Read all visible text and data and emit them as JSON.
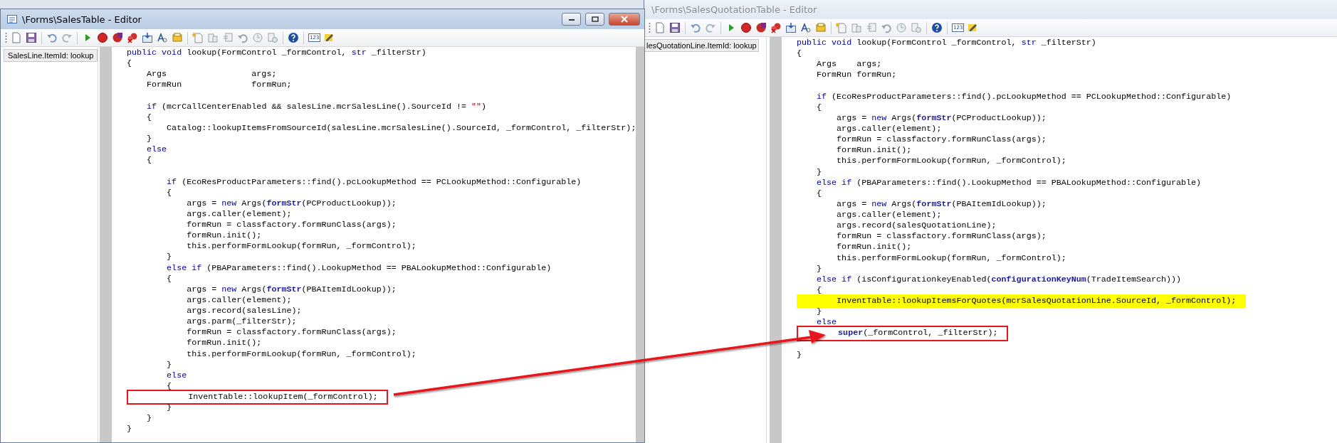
{
  "windows": [
    {
      "title": "\\Forms\\SalesTable - Editor",
      "active": true,
      "toolbar": {
        "badge": "123"
      },
      "tree": {
        "items": [
          {
            "label": "SalesLine.ItemId: lookup",
            "selected": true
          }
        ]
      },
      "code": [
        {
          "kind": "code",
          "segments": [
            {
              "text": "public void",
              "kind": "keyword"
            },
            {
              "text": " lookup(FormControl _formControl, ",
              "kind": "plain"
            },
            {
              "text": "str",
              "kind": "keyword"
            },
            {
              "text": " _filterStr)",
              "kind": "plain"
            }
          ]
        },
        {
          "kind": "code",
          "segments": [
            {
              "text": "{",
              "kind": "plain"
            }
          ]
        },
        {
          "kind": "code",
          "segments": [
            {
              "text": "    Args                 args;",
              "kind": "plain"
            }
          ]
        },
        {
          "kind": "code",
          "segments": [
            {
              "text": "    FormRun              formRun;",
              "kind": "plain"
            }
          ]
        },
        {
          "kind": "blank"
        },
        {
          "kind": "code",
          "segments": [
            {
              "text": "    if",
              "kind": "keyword"
            },
            {
              "text": " (mcrCallCenterEnabled && salesLine.mcrSalesLine().SourceId != ",
              "kind": "plain"
            },
            {
              "text": "\"\"",
              "kind": "string"
            },
            {
              "text": ")",
              "kind": "plain"
            }
          ]
        },
        {
          "kind": "code",
          "segments": [
            {
              "text": "    {",
              "kind": "plain"
            }
          ]
        },
        {
          "kind": "code",
          "segments": [
            {
              "text": "        Catalog::lookupItemsFromSourceId(salesLine.mcrSalesLine().SourceId, _formControl, _filterStr);",
              "kind": "plain"
            }
          ]
        },
        {
          "kind": "code",
          "segments": [
            {
              "text": "    }",
              "kind": "plain"
            }
          ]
        },
        {
          "kind": "code",
          "segments": [
            {
              "text": "    else",
              "kind": "keyword"
            }
          ]
        },
        {
          "kind": "code",
          "segments": [
            {
              "text": "    {",
              "kind": "plain"
            }
          ]
        },
        {
          "kind": "blank"
        },
        {
          "kind": "code",
          "segments": [
            {
              "text": "        if",
              "kind": "keyword"
            },
            {
              "text": " (EcoResProductParameters::find().pcLookupMethod == PCLookupMethod::Configurable)",
              "kind": "plain"
            }
          ]
        },
        {
          "kind": "code",
          "segments": [
            {
              "text": "        {",
              "kind": "plain"
            }
          ]
        },
        {
          "kind": "code",
          "segments": [
            {
              "text": "            args = ",
              "kind": "plain"
            },
            {
              "text": "new",
              "kind": "keyword"
            },
            {
              "text": " Args(",
              "kind": "plain"
            },
            {
              "text": "formStr",
              "kind": "function"
            },
            {
              "text": "(PCProductLookup));",
              "kind": "plain"
            }
          ]
        },
        {
          "kind": "code",
          "segments": [
            {
              "text": "            args.caller(element);",
              "kind": "plain"
            }
          ]
        },
        {
          "kind": "code",
          "segments": [
            {
              "text": "            formRun = classfactory.formRunClass(args);",
              "kind": "plain"
            }
          ]
        },
        {
          "kind": "code",
          "segments": [
            {
              "text": "            formRun.init();",
              "kind": "plain"
            }
          ]
        },
        {
          "kind": "code",
          "segments": [
            {
              "text": "            this.performFormLookup(formRun, _formControl);",
              "kind": "plain"
            }
          ]
        },
        {
          "kind": "code",
          "segments": [
            {
              "text": "        }",
              "kind": "plain"
            }
          ]
        },
        {
          "kind": "code",
          "segments": [
            {
              "text": "        else if",
              "kind": "keyword"
            },
            {
              "text": " (PBAParameters::find().LookupMethod == PBALookupMethod::Configurable)",
              "kind": "plain"
            }
          ]
        },
        {
          "kind": "code",
          "segments": [
            {
              "text": "        {",
              "kind": "plain"
            }
          ]
        },
        {
          "kind": "code",
          "segments": [
            {
              "text": "            args = ",
              "kind": "plain"
            },
            {
              "text": "new",
              "kind": "keyword"
            },
            {
              "text": " Args(",
              "kind": "plain"
            },
            {
              "text": "formStr",
              "kind": "function"
            },
            {
              "text": "(PBAItemIdLookup));",
              "kind": "plain"
            }
          ]
        },
        {
          "kind": "code",
          "segments": [
            {
              "text": "            args.caller(element);",
              "kind": "plain"
            }
          ]
        },
        {
          "kind": "code",
          "segments": [
            {
              "text": "            args.record(salesLine);",
              "kind": "plain"
            }
          ]
        },
        {
          "kind": "code",
          "segments": [
            {
              "text": "            args.parm(_filterStr);",
              "kind": "plain"
            }
          ]
        },
        {
          "kind": "code",
          "segments": [
            {
              "text": "            formRun = classfactory.formRunClass(args);",
              "kind": "plain"
            }
          ]
        },
        {
          "kind": "code",
          "segments": [
            {
              "text": "            formRun.init();",
              "kind": "plain"
            }
          ]
        },
        {
          "kind": "code",
          "segments": [
            {
              "text": "            this.performFormLookup(formRun, _formControl);",
              "kind": "plain"
            }
          ]
        },
        {
          "kind": "code",
          "segments": [
            {
              "text": "        }",
              "kind": "plain"
            }
          ]
        },
        {
          "kind": "code",
          "segments": [
            {
              "text": "        else",
              "kind": "keyword"
            }
          ]
        },
        {
          "kind": "code",
          "segments": [
            {
              "text": "        {",
              "kind": "plain"
            }
          ]
        },
        {
          "kind": "code",
          "boxed": true,
          "segments": [
            {
              "text": "            InventTable::lookupItem(_formControl);",
              "kind": "plain"
            }
          ]
        },
        {
          "kind": "code",
          "segments": [
            {
              "text": "        }",
              "kind": "plain"
            }
          ]
        },
        {
          "kind": "code",
          "segments": [
            {
              "text": "    }",
              "kind": "plain"
            }
          ]
        },
        {
          "kind": "code",
          "segments": [
            {
              "text": "}",
              "kind": "plain"
            }
          ]
        }
      ]
    },
    {
      "title": "\\Forms\\SalesQuotationTable - Editor",
      "active": false,
      "toolbar": {
        "badge": "123"
      },
      "tree": {
        "items": [
          {
            "label": "lesQuotationLine.ItemId: lookup",
            "selected": true
          }
        ]
      },
      "code": [
        {
          "kind": "code",
          "segments": [
            {
              "text": "public void",
              "kind": "keyword"
            },
            {
              "text": " lookup(FormControl _formControl, ",
              "kind": "plain"
            },
            {
              "text": "str",
              "kind": "keyword"
            },
            {
              "text": " _filterStr)",
              "kind": "plain"
            }
          ]
        },
        {
          "kind": "code",
          "segments": [
            {
              "text": "{",
              "kind": "plain"
            }
          ]
        },
        {
          "kind": "code",
          "segments": [
            {
              "text": "    Args    args;",
              "kind": "plain"
            }
          ]
        },
        {
          "kind": "code",
          "segments": [
            {
              "text": "    FormRun formRun;",
              "kind": "plain"
            }
          ]
        },
        {
          "kind": "blank"
        },
        {
          "kind": "code",
          "segments": [
            {
              "text": "    if",
              "kind": "keyword"
            },
            {
              "text": " (EcoResProductParameters::find().pcLookupMethod == PCLookupMethod::Configurable)",
              "kind": "plain"
            }
          ]
        },
        {
          "kind": "code",
          "segments": [
            {
              "text": "    {",
              "kind": "plain"
            }
          ]
        },
        {
          "kind": "code",
          "segments": [
            {
              "text": "        args = ",
              "kind": "plain"
            },
            {
              "text": "new",
              "kind": "keyword"
            },
            {
              "text": " Args(",
              "kind": "plain"
            },
            {
              "text": "formStr",
              "kind": "function"
            },
            {
              "text": "(PCProductLookup));",
              "kind": "plain"
            }
          ]
        },
        {
          "kind": "code",
          "segments": [
            {
              "text": "        args.caller(element);",
              "kind": "plain"
            }
          ]
        },
        {
          "kind": "code",
          "segments": [
            {
              "text": "        formRun = classfactory.formRunClass(args);",
              "kind": "plain"
            }
          ]
        },
        {
          "kind": "code",
          "segments": [
            {
              "text": "        formRun.init();",
              "kind": "plain"
            }
          ]
        },
        {
          "kind": "code",
          "segments": [
            {
              "text": "        this.performFormLookup(formRun, _formControl);",
              "kind": "plain"
            }
          ]
        },
        {
          "kind": "code",
          "segments": [
            {
              "text": "    }",
              "kind": "plain"
            }
          ]
        },
        {
          "kind": "code",
          "segments": [
            {
              "text": "    else if",
              "kind": "keyword"
            },
            {
              "text": " (PBAParameters::find().LookupMethod == PBALookupMethod::Configurable)",
              "kind": "plain"
            }
          ]
        },
        {
          "kind": "code",
          "segments": [
            {
              "text": "    {",
              "kind": "plain"
            }
          ]
        },
        {
          "kind": "code",
          "segments": [
            {
              "text": "        args = ",
              "kind": "plain"
            },
            {
              "text": "new",
              "kind": "keyword"
            },
            {
              "text": " Args(",
              "kind": "plain"
            },
            {
              "text": "formStr",
              "kind": "function"
            },
            {
              "text": "(PBAItemIdLookup));",
              "kind": "plain"
            }
          ]
        },
        {
          "kind": "code",
          "segments": [
            {
              "text": "        args.caller(element);",
              "kind": "plain"
            }
          ]
        },
        {
          "kind": "code",
          "segments": [
            {
              "text": "        args.record(salesQuotationLine);",
              "kind": "plain"
            }
          ]
        },
        {
          "kind": "code",
          "segments": [
            {
              "text": "        formRun = classfactory.formRunClass(args);",
              "kind": "plain"
            }
          ]
        },
        {
          "kind": "code",
          "segments": [
            {
              "text": "        formRun.init();",
              "kind": "plain"
            }
          ]
        },
        {
          "kind": "code",
          "segments": [
            {
              "text": "        this.performFormLookup(formRun, _formControl);",
              "kind": "plain"
            }
          ]
        },
        {
          "kind": "code",
          "segments": [
            {
              "text": "    }",
              "kind": "plain"
            }
          ]
        },
        {
          "kind": "code",
          "segments": [
            {
              "text": "    else if",
              "kind": "keyword"
            },
            {
              "text": " (isConfigurationkeyEnabled(",
              "kind": "plain"
            },
            {
              "text": "configurationKeyNum",
              "kind": "function"
            },
            {
              "text": "(TradeItemSearch)))",
              "kind": "plain"
            }
          ]
        },
        {
          "kind": "code",
          "segments": [
            {
              "text": "    {",
              "kind": "plain"
            }
          ]
        },
        {
          "kind": "code",
          "highlighted": true,
          "segments": [
            {
              "text": "        InventTable::lookupItemsForQuotes(mcrSalesQuotationLine.SourceId, _formControl);",
              "kind": "plain"
            }
          ]
        },
        {
          "kind": "code",
          "segments": [
            {
              "text": "    }",
              "kind": "plain"
            }
          ]
        },
        {
          "kind": "code",
          "segments": [
            {
              "text": "    else",
              "kind": "keyword"
            }
          ]
        },
        {
          "kind": "code",
          "boxed": true,
          "segments": [
            {
              "text": "        super",
              "kind": "function"
            },
            {
              "text": "(_formControl, _filterStr);",
              "kind": "plain"
            }
          ]
        },
        {
          "kind": "blank"
        },
        {
          "kind": "code",
          "segments": [
            {
              "text": "}",
              "kind": "plain"
            }
          ]
        }
      ]
    }
  ]
}
